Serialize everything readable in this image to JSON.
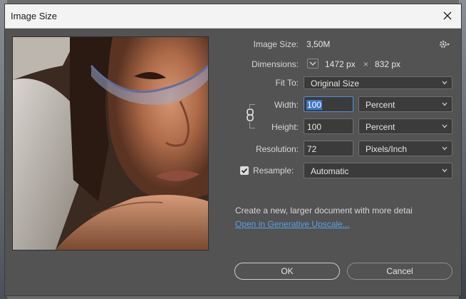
{
  "dialog": {
    "title": "Image Size"
  },
  "info": {
    "image_size_label": "Image Size:",
    "image_size_value": "3,50M",
    "dimensions_label": "Dimensions:",
    "dim_width": "1472 px",
    "dim_times": "×",
    "dim_height": "832 px"
  },
  "form": {
    "fit_to_label": "Fit To:",
    "fit_to_value": "Original Size",
    "width_label": "Width:",
    "width_value": "100",
    "width_unit": "Percent",
    "height_label": "Height:",
    "height_value": "100",
    "height_unit": "Percent",
    "resolution_label": "Resolution:",
    "resolution_value": "72",
    "resolution_unit": "Pixels/Inch",
    "resample_label": "Resample:",
    "resample_checked": true,
    "resample_value": "Automatic"
  },
  "upscale": {
    "description": "Create a new, larger document with more detai",
    "link": "Open in Generative Upscale..."
  },
  "buttons": {
    "ok": "OK",
    "cancel": "Cancel"
  },
  "icons": {
    "gear": "gear-icon",
    "close": "close-icon",
    "chain": "chain-link-icon",
    "check": "checkmark-icon",
    "chevron": "chevron-down-icon"
  }
}
